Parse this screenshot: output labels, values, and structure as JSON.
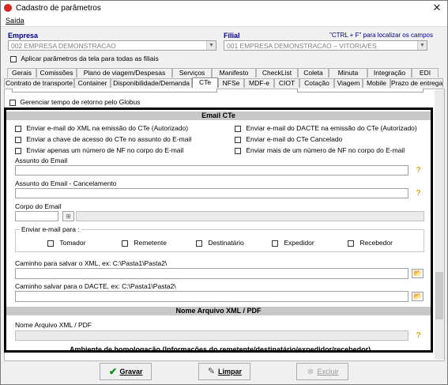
{
  "window": {
    "title": "Cadastro de parâmetros"
  },
  "menu": {
    "saida": "Saída"
  },
  "empresa": {
    "label": "Empresa",
    "value": "002 EMPRESA DEMONSTRACAO"
  },
  "filial": {
    "label": "Filial",
    "value": "001 EMPRESA DEMONSTRACAO – VITORIA/ES",
    "hint": "\"CTRL + F\" para localizar os campos"
  },
  "aplicar": {
    "label": "Aplicar parâmetros da tela para todas as filiais"
  },
  "tabs_row1": [
    "Gerais",
    "Comissões",
    "Plano de viagem/Despesas",
    "Serviços",
    "Manifesto",
    "CheckList",
    "Coleta",
    "Minuta",
    "Integração",
    "EDI"
  ],
  "tabs_row2": [
    "Contrato de transporte",
    "Container",
    "Disponibilidade/Demanda",
    "CTe",
    "NFSe",
    "MDF-e",
    "CIOT",
    "Cotação",
    "Viagem",
    "Mobile",
    "Prazo de entrega"
  ],
  "selected_tab": "CTe",
  "gerenciar": {
    "label": "Gerenciar tempo de retorno pelo Globus"
  },
  "email": {
    "header": "Email CTe",
    "checks_left": [
      "Enviar e-mail do XML na emissão do CTe (Autorizado)",
      "Enviar a chave de acesso do CTe no assunto do E-mail",
      "Enviar apenas um número de NF no corpo do E-mail"
    ],
    "checks_right": [
      "Enviar e-mail do DACTE na emissão do CTe (Autorizado)",
      "Enviar e-mail do CTe Cancelado",
      "Enviar mais de um número de NF no corpo do E-mail"
    ],
    "assunto_label": "Assunto do Email",
    "assunto_cancel_label": "Assunto do Email - Cancelamento",
    "corpo_label": "Corpo do Email",
    "enviar_para": {
      "label": "Enviar e-mail para :",
      "options": [
        "Tomador",
        "Remetente",
        "Destinatário",
        "Expedidor",
        "Recebedor"
      ]
    },
    "xml_path_label": "Caminho para salvar o XML, ex: C:\\Pasta1\\Pasta2\\",
    "dacte_path_label": "Caminho salvar para o DACTE, ex: C:\\Pasta1\\Pasta2\\"
  },
  "nome_arquivo": {
    "header": "Nome Arquivo XML / PDF",
    "label": "Nome Arquivo XML / PDF"
  },
  "homologacao": {
    "text": "Ambiente de homologação (Informações do remetente/destinatário/expedidor/recebedor)"
  },
  "buttons": {
    "gravar": "Gravar",
    "limpar": "Limpar",
    "excluir": "Excluir"
  }
}
